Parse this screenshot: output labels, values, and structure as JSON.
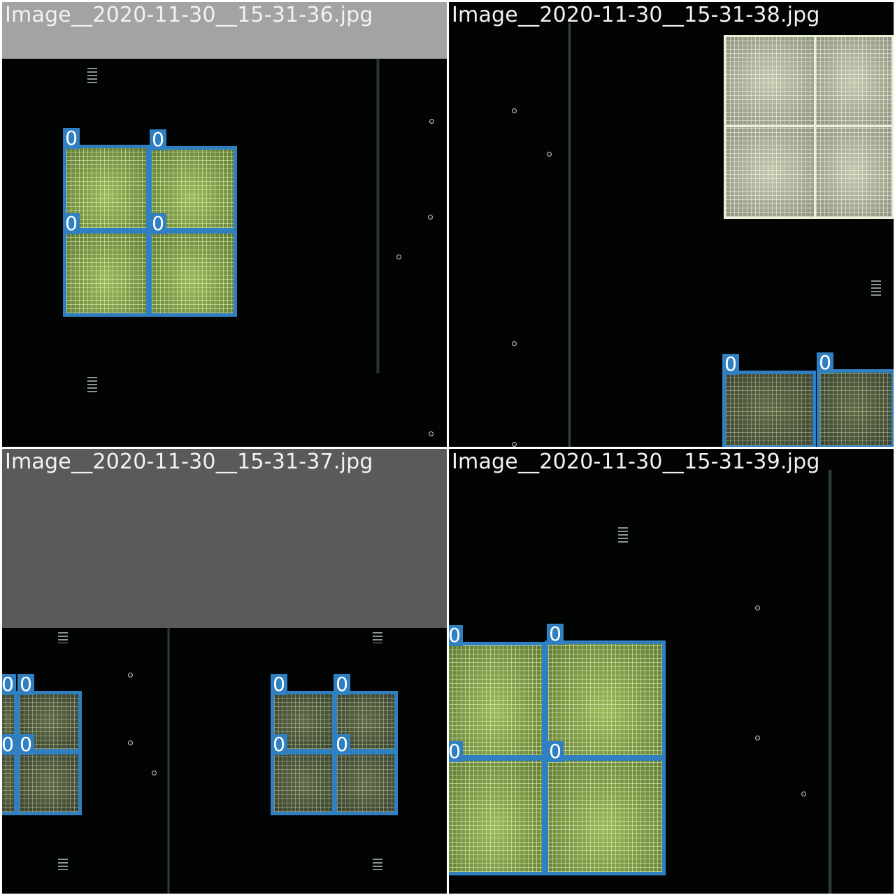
{
  "panels": [
    {
      "title": "Image__2020-11-30__15-31-36.jpg",
      "gray_band_color": "#a3a3a3",
      "detections": [
        "0",
        "0",
        "0",
        "0"
      ]
    },
    {
      "title": "Image__2020-11-30__15-31-38.jpg",
      "detections": [
        "0",
        "0"
      ]
    },
    {
      "title": "Image__2020-11-30__15-31-37.jpg",
      "gray_band_color": "#5a5a5a",
      "detections": [
        "0",
        "0",
        "0",
        "0",
        "0",
        "0",
        "0",
        "0"
      ]
    },
    {
      "title": "Image__2020-11-30__15-31-39.jpg",
      "detections": [
        "0",
        "0",
        "0",
        "0"
      ]
    }
  ],
  "colors": {
    "box": "#2f7fc1",
    "label_text": "#ffffff",
    "background": "#020303",
    "title_text": "#f2f2f2"
  }
}
